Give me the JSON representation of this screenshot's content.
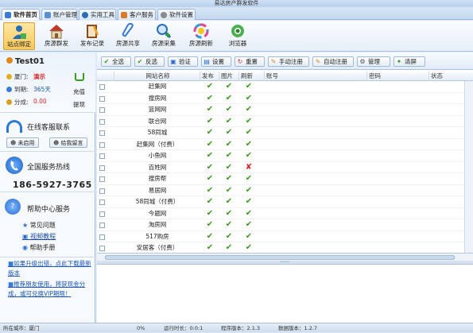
{
  "window": {
    "title": "易达房产群发软件"
  },
  "tabs": [
    {
      "label": "软件首页",
      "color": "#3a7bd5"
    },
    {
      "label": "账户管理",
      "color": "#5a8fd0"
    },
    {
      "label": "实用工具",
      "color": "#2a6cb6"
    },
    {
      "label": "客户服务",
      "color": "#d77a2a"
    },
    {
      "label": "软件设置",
      "color": "#8a8a8a"
    }
  ],
  "toolbar": [
    {
      "label": "站点绑定",
      "icon": "user-bind-icon"
    },
    {
      "label": "房源群发",
      "icon": "house-icon"
    },
    {
      "label": "发布记录",
      "icon": "record-book-icon"
    },
    {
      "label": "房源共享",
      "icon": "paperclip-icon"
    },
    {
      "label": "房源采集",
      "icon": "magnifier-icon"
    },
    {
      "label": "房源刷新",
      "icon": "refresh-ring-icon"
    },
    {
      "label": "浏览器",
      "icon": "browser-icon"
    }
  ],
  "user": {
    "name": "Test01",
    "city_label": "厦门:",
    "city_value": "演示",
    "expire_label": "到期:",
    "expire_value": "365天",
    "points_label": "分成:",
    "points_value": "0.00",
    "recharge": "充值",
    "withdraw": "提现"
  },
  "service": {
    "title": "在线客服联系",
    "btn_disabled": "未启用",
    "btn_message": "给我留言"
  },
  "hotline": {
    "title": "全国服务热线",
    "number": "186-5927-3765"
  },
  "help": {
    "title": "帮助中心服务",
    "links": [
      "常见问题",
      "视频教程",
      "帮助手册"
    ]
  },
  "notices": [
    "如果升级出错，点此下载最新版本",
    "推荐朋友使用，将获现金分成，或可兑换VIP期限！"
  ],
  "actions": [
    {
      "label": "全选",
      "icon": "✔"
    },
    {
      "label": "反选",
      "icon": "✔"
    },
    {
      "label": "验证",
      "icon": "▣"
    },
    {
      "label": "设置",
      "icon": "▤"
    },
    {
      "label": "重置",
      "icon": "↻"
    },
    {
      "label": "手动注册",
      "icon": "✎"
    },
    {
      "label": "自动注册",
      "icon": "✎"
    },
    {
      "label": "管理",
      "icon": "⚙"
    },
    {
      "label": "清屏",
      "icon": "✦"
    }
  ],
  "grid": {
    "headers": [
      "网站名称",
      "发布",
      "图片",
      "刷新",
      "账号",
      "密码",
      "状态"
    ],
    "rows": [
      {
        "name": "赶集网",
        "publish": true,
        "image": true,
        "refresh": true
      },
      {
        "name": "搜房网",
        "publish": true,
        "image": true,
        "refresh": true
      },
      {
        "name": "篮网网",
        "publish": true,
        "image": true,
        "refresh": true
      },
      {
        "name": "联合网",
        "publish": true,
        "image": true,
        "refresh": true
      },
      {
        "name": "58同城",
        "publish": true,
        "image": true,
        "refresh": true
      },
      {
        "name": "赶集网（付费）",
        "publish": true,
        "image": true,
        "refresh": true
      },
      {
        "name": "小鱼网",
        "publish": true,
        "image": true,
        "refresh": true
      },
      {
        "name": "百姓网",
        "publish": true,
        "image": true,
        "refresh": false
      },
      {
        "name": "搜房帮",
        "publish": true,
        "image": true,
        "refresh": true
      },
      {
        "name": "易居网",
        "publish": true,
        "image": true,
        "refresh": true
      },
      {
        "name": "58同城（付费）",
        "publish": true,
        "image": true,
        "refresh": true
      },
      {
        "name": "今题网",
        "publish": true,
        "image": true,
        "refresh": true
      },
      {
        "name": "淘房网",
        "publish": true,
        "image": true,
        "refresh": true
      },
      {
        "name": "517购房",
        "publish": true,
        "image": true,
        "refresh": true
      },
      {
        "name": "安居客（付费）",
        "publish": true,
        "image": true,
        "refresh": true
      }
    ]
  },
  "status": {
    "city": "所在城市：厦门",
    "progress": "0%",
    "runtime": "运行时长：0:0:1",
    "program_version": "程序版本：2.1.3",
    "data_version": "数据版本：1.2.7"
  },
  "colors": {
    "check": "#3a9a1e",
    "cross": "#dd2222",
    "red_value": "#e02020",
    "link": "#1c55b4"
  }
}
